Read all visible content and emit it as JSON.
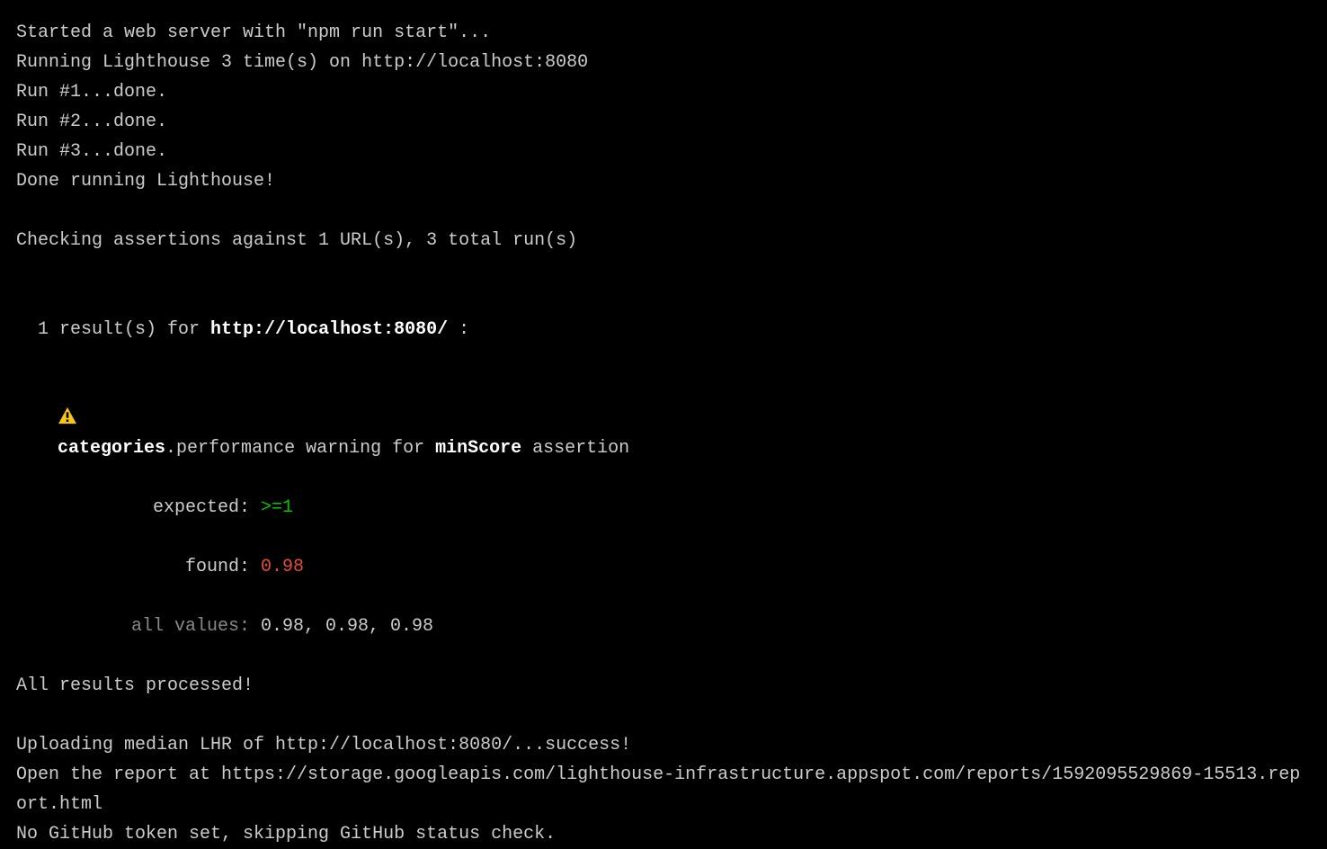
{
  "lines": {
    "started": "Started a web server with \"npm run start\"...",
    "running": "Running Lighthouse 3 time(s) on http://localhost:8080",
    "run1": "Run #1...done.",
    "run2": "Run #2...done.",
    "run3": "Run #3...done.",
    "done_running": "Done running Lighthouse!",
    "checking": "Checking assertions against 1 URL(s), 3 total run(s)",
    "results_prefix": "1 result(s) for ",
    "results_url": "http://localhost:8080/",
    "results_suffix": " :",
    "assertion": {
      "category_bold": "categories",
      "middle": ".performance warning for ",
      "min_score_bold": "minScore",
      "suffix": " assertion",
      "expected_label": "expected:",
      "expected_value": " >=1",
      "found_label": "found:",
      "found_value": " 0.98",
      "all_values_label": "all values:",
      "all_values_value": " 0.98, 0.98, 0.98"
    },
    "all_processed": "All results processed!",
    "uploading": "Uploading median LHR of http://localhost:8080/...success!",
    "open_report": "Open the report at https://storage.googleapis.com/lighthouse-infrastructure.appspot.com/reports/1592095529869-15513.report.html",
    "no_github": "No GitHub token set, skipping GitHub status check."
  }
}
